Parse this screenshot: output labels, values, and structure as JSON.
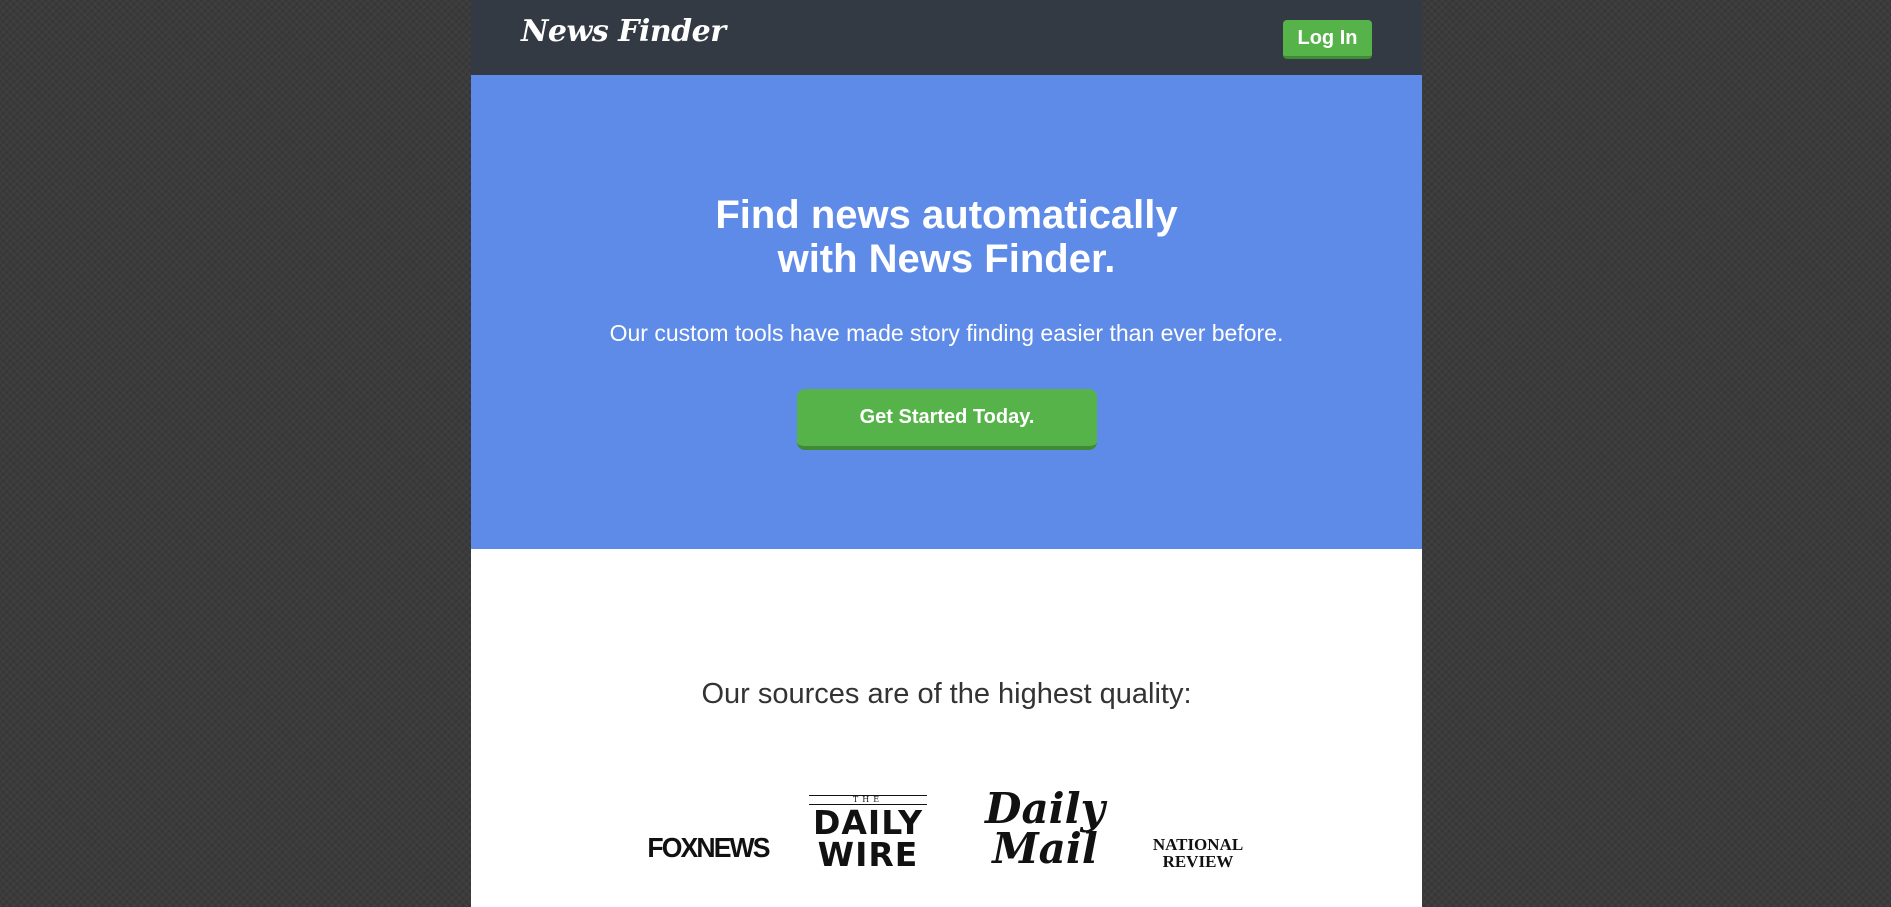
{
  "header": {
    "brand": "News Finder",
    "login_label": "Log In"
  },
  "hero": {
    "title_line1": "Find news automatically",
    "title_line2": "with News Finder.",
    "subtitle": "Our custom tools have made story finding easier than ever before.",
    "cta_label": "Get Started Today."
  },
  "sources": {
    "heading": "Our sources are of the highest quality:",
    "logos": [
      {
        "name": "FOX NEWS",
        "text": "FOXNEWS"
      },
      {
        "name": "The Daily Wire",
        "top": "THE",
        "line1": "DAILY",
        "line2": "WIRE"
      },
      {
        "name": "Daily Mail",
        "line1": "Daily",
        "line2": "Mail"
      },
      {
        "name": "National Review",
        "line1": "NATIONAL",
        "line2": "REVIEW"
      }
    ]
  },
  "colors": {
    "header_bg": "#343a44",
    "hero_bg": "#5e8be8",
    "button_green": "#56b34a",
    "page_bg": "#3b3b3b"
  }
}
